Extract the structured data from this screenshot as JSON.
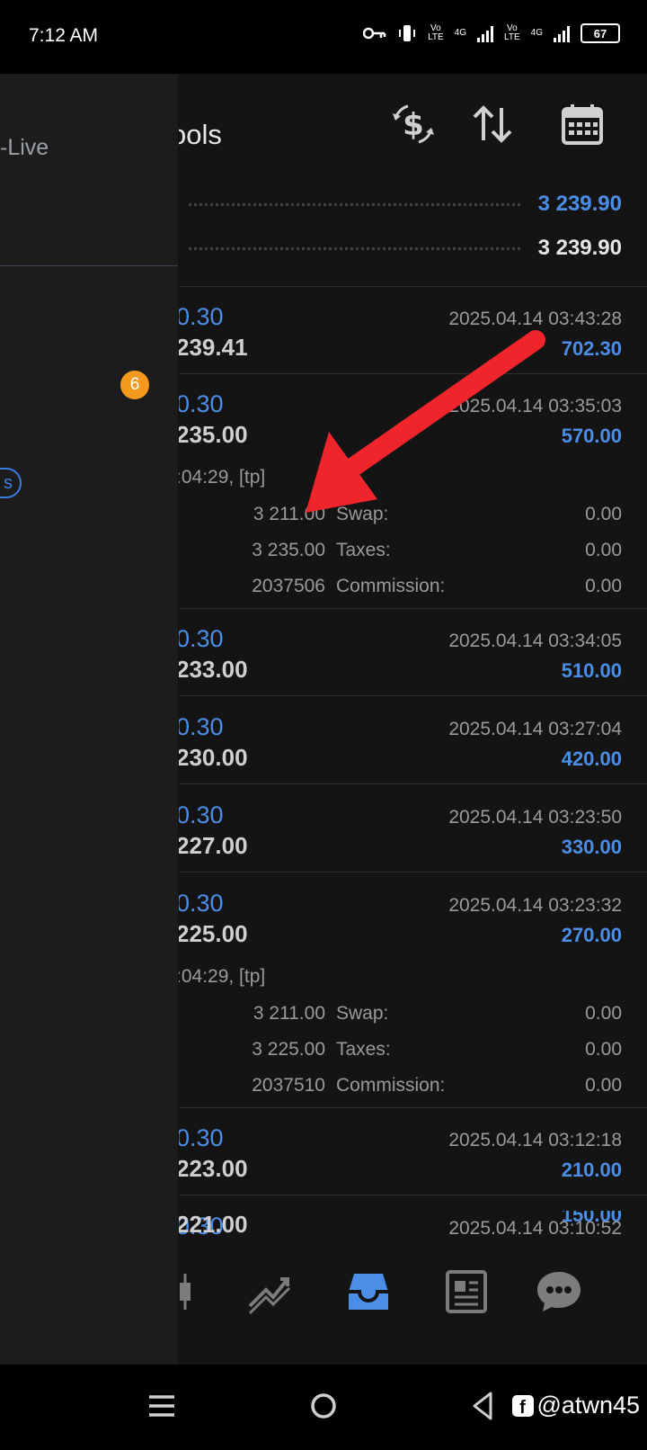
{
  "status_bar": {
    "time": "7:12 AM",
    "battery": "67",
    "net1_top": "Vo",
    "net1_bottom": "LTE",
    "net_type": "4G"
  },
  "toolbar": {
    "title": "ools",
    "icons": [
      "currency-exchange-icon",
      "sort-icon",
      "calendar-icon"
    ]
  },
  "summary": {
    "value1": "3 239.90",
    "value2": "3 239.90",
    "value1_color": "#4a8ee8",
    "value2_color": "#e6e6e6"
  },
  "deals": [
    {
      "volume": "0.30",
      "price": "239.41",
      "datetime": "2025.04.14 03:43:28",
      "profit": "702.30"
    },
    {
      "volume": "0.30",
      "price": "235.00",
      "datetime": "2025.04.14 03:35:03",
      "profit": "570.00",
      "expanded": {
        "close": ":04:29, [tp]",
        "sl": "3 211.00",
        "tp": "3 235.00",
        "id": "2037506",
        "swap_label": "Swap:",
        "swap": "0.00",
        "taxes_label": "Taxes:",
        "taxes": "0.00",
        "commission_label": "Commission:",
        "commission": "0.00"
      }
    },
    {
      "volume": "0.30",
      "price": "233.00",
      "datetime": "2025.04.14 03:34:05",
      "profit": "510.00"
    },
    {
      "volume": "0.30",
      "price": "230.00",
      "datetime": "2025.04.14 03:27:04",
      "profit": "420.00"
    },
    {
      "volume": "0.30",
      "price": "227.00",
      "datetime": "2025.04.14 03:23:50",
      "profit": "330.00"
    },
    {
      "volume": "0.30",
      "price": "225.00",
      "datetime": "2025.04.14 03:23:32",
      "profit": "270.00",
      "expanded": {
        "close": ":04:29, [tp]",
        "sl": "3 211.00",
        "tp": "3 225.00",
        "id": "2037510",
        "swap_label": "Swap:",
        "swap": "0.00",
        "taxes_label": "Taxes:",
        "taxes": "0.00",
        "commission_label": "Commission:",
        "commission": "0.00"
      }
    },
    {
      "volume": "0.30",
      "price": "223.00",
      "datetime": "2025.04.14 03:12:18",
      "profit": "210.00"
    },
    {
      "volume": "0.30",
      "price": "221.00",
      "datetime": "2025.04.14 03:10:52",
      "profit": "150.00"
    }
  ],
  "drawer": {
    "account_suffix": "-Live",
    "badge": "6",
    "pill_text": "s"
  },
  "bottom_nav": {
    "items": [
      "candlestick-icon",
      "trade-chart-icon",
      "history-inbox-icon",
      "news-icon",
      "chat-icon"
    ],
    "active": "history-inbox-icon",
    "active_color": "#4a8ee8"
  },
  "annotation": {
    "arrow_color": "#f0252c"
  },
  "system_nav": {
    "watermark": "@atwn45"
  }
}
